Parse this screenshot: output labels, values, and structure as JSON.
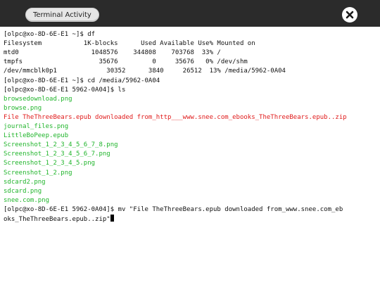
{
  "window": {
    "tab_label": "Terminal Activity",
    "close_icon": "close-icon"
  },
  "terminal": {
    "colors": {
      "default": "#111111",
      "file_image": "#21b52c",
      "file_error": "#e01a1a"
    },
    "lines": [
      {
        "text": "[olpc@xo-8D-6E-E1 ~]$ df",
        "style": "default"
      },
      {
        "text": "Filesystem           1K-blocks      Used Available Use% Mounted on",
        "style": "default"
      },
      {
        "text": "mtd0                   1048576    344808    703768  33% /",
        "style": "default"
      },
      {
        "text": "tmpfs                    35676         0     35676   0% /dev/shm",
        "style": "default"
      },
      {
        "text": "/dev/mmcblk0p1             30352      3840     26512  13% /media/5962-0A04",
        "style": "default"
      },
      {
        "text": "[olpc@xo-8D-6E-E1 ~]$ cd /media/5962-0A04",
        "style": "default"
      },
      {
        "text": "[olpc@xo-8D-6E-E1 5962-0A04]$ ls",
        "style": "default"
      },
      {
        "text": "browsedownload.png",
        "style": "green"
      },
      {
        "text": "browse.png",
        "style": "green"
      },
      {
        "text": "File TheThreeBears.epub downloaded from_http___www.snee.com_ebooks_TheThreeBears.epub..zip",
        "style": "red"
      },
      {
        "text": "journal_files.png",
        "style": "green"
      },
      {
        "text": "LittleBoPeep.epub",
        "style": "green"
      },
      {
        "text": "Screenshot_1_2_3_4_5_6_7_8.png",
        "style": "green"
      },
      {
        "text": "Screenshot_1_2_3_4_5_6_7.png",
        "style": "green"
      },
      {
        "text": "Screenshot_1_2_3_4_5.png",
        "style": "green"
      },
      {
        "text": "Screenshot_1_2.png",
        "style": "green"
      },
      {
        "text": "sdcard2.png",
        "style": "green"
      },
      {
        "text": "sdcard.png",
        "style": "green"
      },
      {
        "text": "snee.com.png",
        "style": "green"
      },
      {
        "text": "[olpc@xo-8D-6E-E1 5962-0A04]$ mv \"File TheThreeBears.epub downloaded from_www.snee.com_eb",
        "style": "default"
      },
      {
        "text": "oks_TheThreeBears.epub..zip\"",
        "style": "default",
        "cursor": true
      }
    ]
  }
}
